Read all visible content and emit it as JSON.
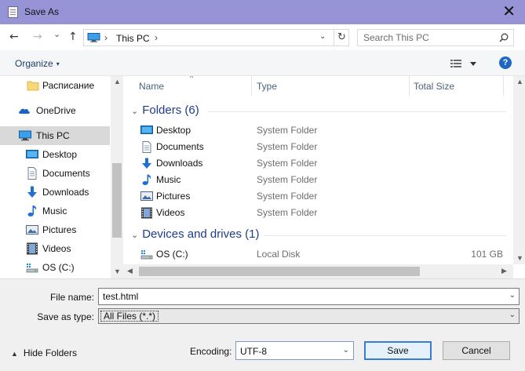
{
  "window": {
    "title": "Save As",
    "close_glyph": "✕",
    "title_color": "#9694d6"
  },
  "nav": {
    "back_glyph": "←",
    "forward_glyph": "→",
    "recent_glyph": "⌄",
    "up_glyph": "↑",
    "address": {
      "location": "This PC",
      "separator": "›",
      "drop_glyph": "⌄",
      "refresh_glyph": "↻"
    },
    "search_placeholder": "Search This PC"
  },
  "toolbar": {
    "organize_label": "Organize",
    "caret": "▾",
    "help_label": "?"
  },
  "sidebar": {
    "items": [
      {
        "label": "Расписание",
        "icon": "folder-icon",
        "selected": false
      },
      {
        "label": "OneDrive",
        "icon": "cloud-icon",
        "selected": false
      },
      {
        "label": "This PC",
        "icon": "computer-icon",
        "selected": true
      },
      {
        "label": "Desktop",
        "icon": "desktop-icon",
        "selected": false
      },
      {
        "label": "Documents",
        "icon": "documents-icon",
        "selected": false
      },
      {
        "label": "Downloads",
        "icon": "downloads-icon",
        "selected": false
      },
      {
        "label": "Music",
        "icon": "music-icon",
        "selected": false
      },
      {
        "label": "Pictures",
        "icon": "pictures-icon",
        "selected": false
      },
      {
        "label": "Videos",
        "icon": "videos-icon",
        "selected": false
      },
      {
        "label": "OS (C:)",
        "icon": "drive-icon",
        "selected": false
      }
    ]
  },
  "content": {
    "columns": {
      "name": "Name",
      "type": "Type",
      "size": "Total Size",
      "sort_glyph": "^"
    },
    "groups": [
      {
        "title": "Folders (6)",
        "rows": [
          {
            "name": "Desktop",
            "type": "System Folder",
            "size": "",
            "icon": "desktop-icon"
          },
          {
            "name": "Documents",
            "type": "System Folder",
            "size": "",
            "icon": "documents-icon"
          },
          {
            "name": "Downloads",
            "type": "System Folder",
            "size": "",
            "icon": "downloads-icon"
          },
          {
            "name": "Music",
            "type": "System Folder",
            "size": "",
            "icon": "music-icon"
          },
          {
            "name": "Pictures",
            "type": "System Folder",
            "size": "",
            "icon": "pictures-icon"
          },
          {
            "name": "Videos",
            "type": "System Folder",
            "size": "",
            "icon": "videos-icon"
          }
        ]
      },
      {
        "title": "Devices and drives (1)",
        "rows": [
          {
            "name": "OS (C:)",
            "type": "Local Disk",
            "size": "101 GB",
            "icon": "drive-icon"
          }
        ]
      }
    ],
    "group_chevron": "⌄"
  },
  "form": {
    "filename_label": "File name:",
    "filename_value": "test.html",
    "savetype_label": "Save as type:",
    "savetype_value": "All Files  (*.*)",
    "drop_glyph": "⌄",
    "hide_folders_label": "Hide Folders",
    "hide_caret": "▲",
    "encoding_label": "Encoding:",
    "encoding_value": "UTF-8",
    "save_label": "Save",
    "cancel_label": "Cancel"
  },
  "scroll_glyphs": {
    "up": "▲",
    "down": "▼",
    "left": "◀",
    "right": "▶"
  }
}
